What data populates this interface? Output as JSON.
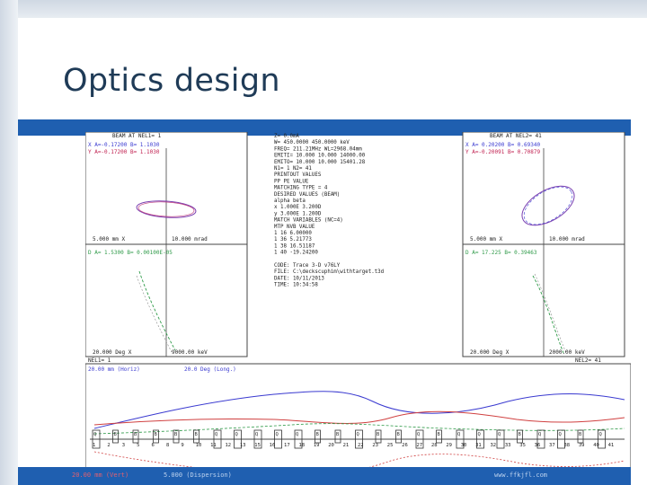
{
  "slide": {
    "title": "Optics design"
  },
  "left_panel": {
    "header": "BEAM AT NEL1=   1",
    "beam_line1": "X  A=-0.17200      B=  1.1030",
    "beam_line2": "Y  A=-0.17200      B=  1.1030",
    "scale_x": "5.000 mm    X",
    "scale_y": "10.000 mrad",
    "disp_line": "D  A=  1.5300      B= 0.00100E-05",
    "scale_x2": "20.000 Deg    X",
    "scale_y2": "9000.00 keV"
  },
  "right_panel": {
    "header": "BEAM AT NEL2=  41",
    "beam_line1": "X  A= 0.20200      B=  0.69340",
    "beam_line2": "Y  A=-0.20091      B=  0.70879",
    "scale_x": "5.000 mm    X",
    "scale_y": "10.000 mrad",
    "disp_line": "D  A=  17.225      B=  0.39463",
    "scale_x2": "20.000 Deg    X",
    "scale_y2": "2000.00 keV"
  },
  "center_text": {
    "lines": [
      "Z=      0.0mA",
      "W= 450.0000  450.0000 keV",
      "FREQ=  211.21MHz    WL=2968.04mm",
      "EMITI=  10.000   10.000  14000.00",
      "EMITO=  10.000   10.000  15401.28",
      "N1=   1   N2=   41",
      "PRINTOUT VALUES",
      "PP PE     VALUE",
      "MATCHING TYPE =  4",
      "DESIRED VALUES (BEAM)",
      "   alpha     beta",
      "x   1.000E   3.200D",
      "y   3.000E   1.200D",
      "MATCH VARIABLES (NC=4)",
      "  MTP NVB     VALUE",
      "   1   16     6.00000",
      "   1   36     5.21773",
      "   1   38    16.51187",
      "   1   40   -19.24200",
      "",
      "CODE: Trace 3-D v76LY",
      "FILE: C:\\deckscuphim\\withtarget.t3d",
      "DATE: 10/11/2013",
      "TIME: 10:34:58"
    ]
  },
  "profile": {
    "nel1_label": "NEL1=   1",
    "nel2_label": "NEL2=  41",
    "scale_left": "20.00 mm (Horiz)",
    "scale_mid": "20.0 Deg (Long.)",
    "element_markers": [
      "Q",
      "B",
      "B",
      "B",
      "B",
      "B",
      "Q",
      "Q",
      "Q",
      "Q",
      "Q",
      "B",
      "B",
      "Q",
      "B",
      "B",
      "Q",
      "B",
      "Q",
      "Q",
      "Q",
      "B",
      "Q",
      "Q",
      "B",
      "Q"
    ],
    "element_numbers": [
      "1",
      "2",
      "3",
      "5",
      "6",
      "8",
      "9",
      "10",
      "11",
      "12",
      "13",
      "15",
      "16",
      "17",
      "18",
      "19",
      "20",
      "21",
      "22",
      "23",
      "25",
      "26",
      "27",
      "28",
      "29",
      "30",
      "31",
      "32",
      "33",
      "35",
      "36",
      "37",
      "38",
      "39",
      "40",
      "41"
    ]
  },
  "footer": {
    "caption_left": "20.00 mm (Vert)",
    "caption_mid": "5.000 (Dispersion)",
    "caption_right": "www.ffkjfl.com"
  },
  "colors": {
    "accent_blue": "#1f5fb0",
    "beam_x": "#3a3ad0",
    "beam_y": "#c02050",
    "envelope_purple": "#7a3fb0",
    "envelope_green": "#2e9a48",
    "envelope_red": "#d04040"
  }
}
